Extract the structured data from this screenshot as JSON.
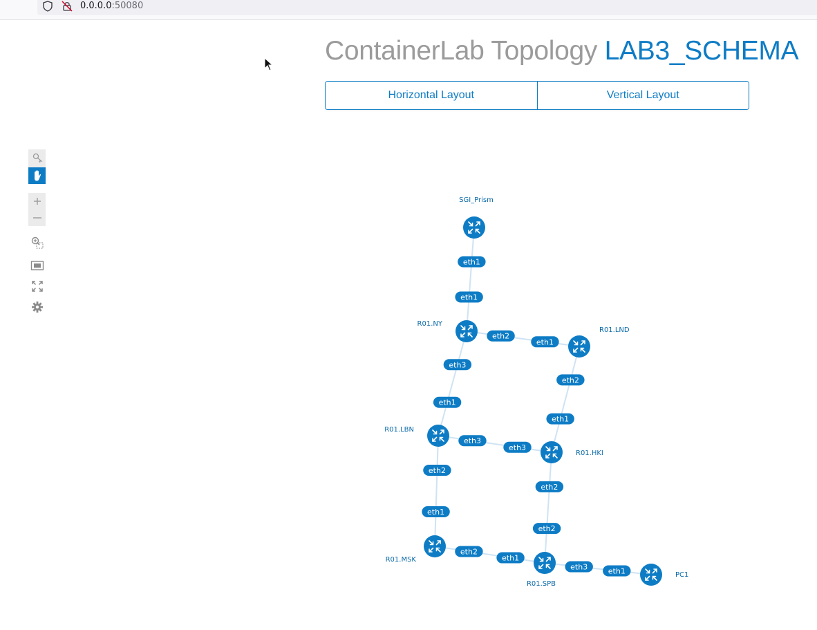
{
  "browser": {
    "url_host": "0.0.0.0",
    "url_port": ":50080"
  },
  "header": {
    "title_prefix": "ContainerLab Topology",
    "topology_name": "LAB3_SCHEMA"
  },
  "layout_buttons": {
    "horizontal": "Horizontal Layout",
    "vertical": "Vertical Layout"
  },
  "toolbar": {
    "icons": [
      "select-icon",
      "pan-hand-icon",
      "zoom-in-icon",
      "zoom-out-icon",
      "zoom-selection-icon",
      "fit-screen-icon",
      "fullscreen-icon",
      "settings-gear-icon"
    ],
    "active": "pan-hand-icon",
    "accent": "#0e7cc5"
  },
  "topology": {
    "node_color": "#0e7cc5",
    "link_color": "#cfe3f3",
    "nodes": [
      {
        "id": "SGI_Prism",
        "label": "SGI_Prism"
      },
      {
        "id": "R01.NY",
        "label": "R01.NY"
      },
      {
        "id": "R01.LND",
        "label": "R01.LND"
      },
      {
        "id": "R01.LBN",
        "label": "R01.LBN"
      },
      {
        "id": "R01.HKI",
        "label": "R01.HKI"
      },
      {
        "id": "R01.MSK",
        "label": "R01.MSK"
      },
      {
        "id": "R01.SPB",
        "label": "R01.SPB"
      },
      {
        "id": "PC1",
        "label": "PC1"
      }
    ],
    "links": [
      {
        "source": "SGI_Prism",
        "target": "R01.NY",
        "source_if": "eth1",
        "target_if": "eth1"
      },
      {
        "source": "R01.NY",
        "target": "R01.LND",
        "source_if": "eth2",
        "target_if": "eth1"
      },
      {
        "source": "R01.NY",
        "target": "R01.LBN",
        "source_if": "eth3",
        "target_if": "eth1"
      },
      {
        "source": "R01.LND",
        "target": "R01.HKI",
        "source_if": "eth2",
        "target_if": "eth1"
      },
      {
        "source": "R01.LBN",
        "target": "R01.HKI",
        "source_if": "eth3",
        "target_if": "eth3"
      },
      {
        "source": "R01.LBN",
        "target": "R01.MSK",
        "source_if": "eth2",
        "target_if": "eth1"
      },
      {
        "source": "R01.HKI",
        "target": "R01.SPB",
        "source_if": "eth2",
        "target_if": "eth2"
      },
      {
        "source": "R01.MSK",
        "target": "R01.SPB",
        "source_if": "eth2",
        "target_if": "eth1"
      },
      {
        "source": "R01.SPB",
        "target": "PC1",
        "source_if": "eth3",
        "target_if": "eth1"
      }
    ]
  }
}
